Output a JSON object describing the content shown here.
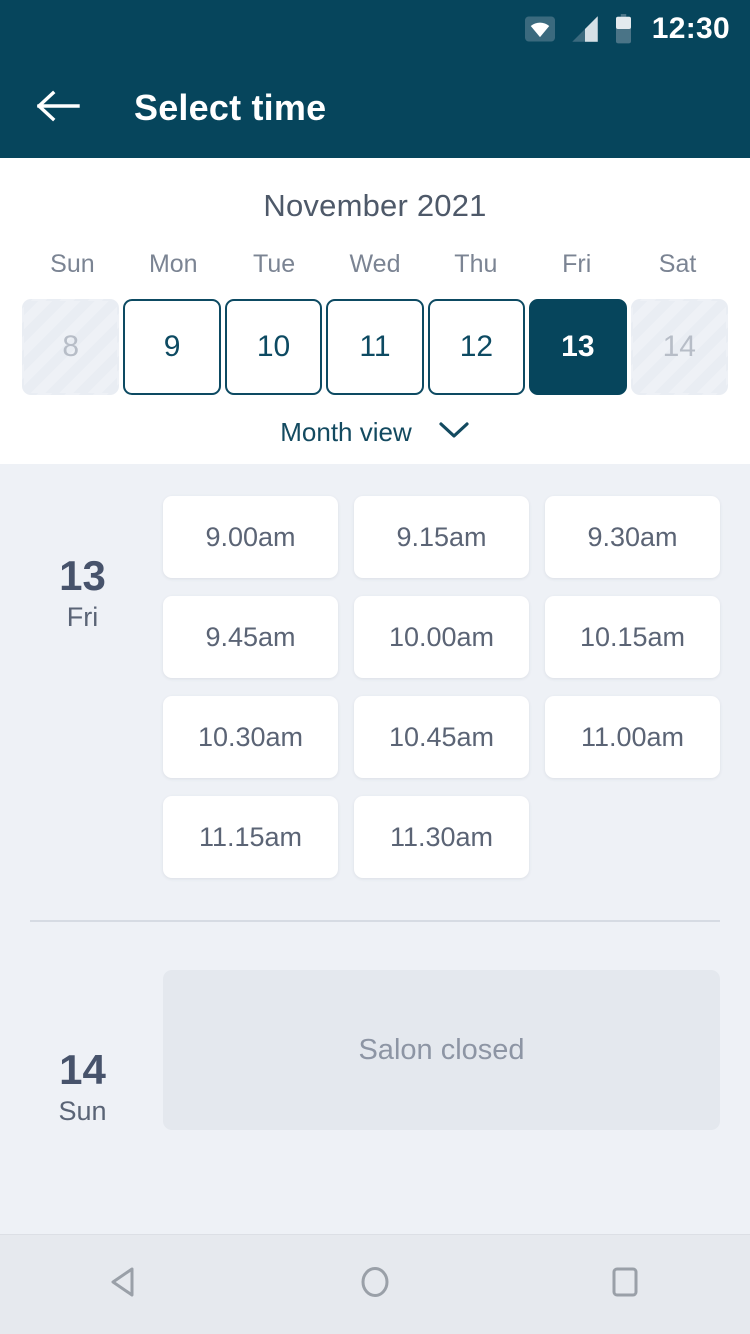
{
  "statusbar": {
    "time": "12:30",
    "icons": [
      "wifi-icon",
      "cellular-signal-icon",
      "battery-icon"
    ]
  },
  "appbar": {
    "back_icon": "arrow-left-icon",
    "title": "Select time"
  },
  "calendar": {
    "month_label": "November 2021",
    "weekdays": [
      "Sun",
      "Mon",
      "Tue",
      "Wed",
      "Thu",
      "Fri",
      "Sat"
    ],
    "days": [
      {
        "num": "8",
        "state": "disabled"
      },
      {
        "num": "9",
        "state": "enabled"
      },
      {
        "num": "10",
        "state": "enabled"
      },
      {
        "num": "11",
        "state": "enabled"
      },
      {
        "num": "12",
        "state": "enabled"
      },
      {
        "num": "13",
        "state": "selected"
      },
      {
        "num": "14",
        "state": "disabled"
      }
    ],
    "view_toggle_label": "Month view",
    "view_toggle_icon": "chevron-down-icon"
  },
  "schedule": [
    {
      "day_num": "13",
      "day_of_week": "Fri",
      "slots": [
        "9.00am",
        "9.15am",
        "9.30am",
        "9.45am",
        "10.00am",
        "10.15am",
        "10.30am",
        "10.45am",
        "11.00am",
        "11.15am",
        "11.30am"
      ],
      "closed_message": ""
    },
    {
      "day_num": "14",
      "day_of_week": "Sun",
      "slots": [],
      "closed_message": "Salon closed"
    }
  ],
  "navbar": {
    "back_label": "back-triangle-icon",
    "home_label": "home-circle-icon",
    "recents_label": "recents-square-icon"
  },
  "colors": {
    "brand_dark_teal": "#06455c",
    "page_background": "#eef1f6",
    "slot_text": "#5b6475",
    "day_label": "#47536b"
  }
}
